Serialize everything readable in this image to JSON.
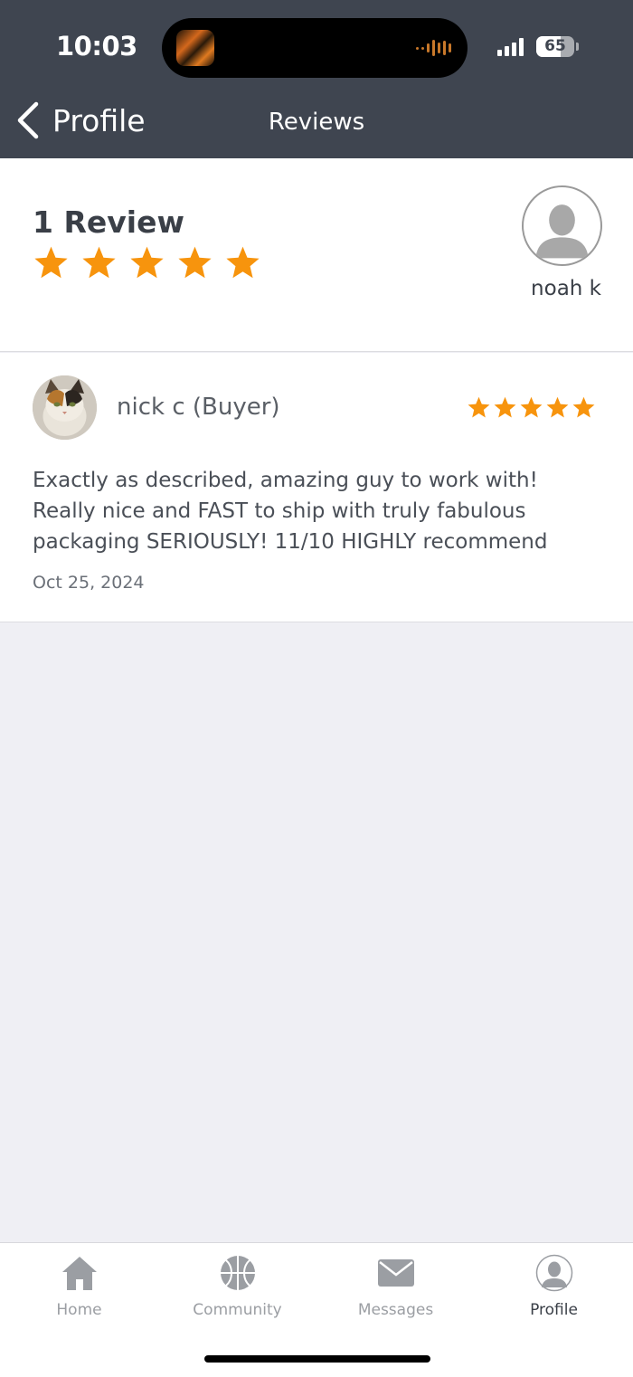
{
  "status_bar": {
    "time": "10:03",
    "battery": "65",
    "battery_level": 0.65
  },
  "nav": {
    "back_label": "Profile",
    "title": "Reviews"
  },
  "summary": {
    "review_count": "1 Review",
    "rating": 5,
    "seller_name": "noah k"
  },
  "reviews": [
    {
      "reviewer": "nick c (Buyer)",
      "rating": 5,
      "text": "Exactly as described, amazing guy to work with! Really nice and FAST to ship with truly fabulous packaging SERIOUSLY! 11/10 HIGHLY recommend",
      "date": "Oct 25, 2024"
    }
  ],
  "tabbar": {
    "tabs": [
      {
        "label": "Home",
        "icon": "home-icon",
        "active": false
      },
      {
        "label": "Community",
        "icon": "basketball-icon",
        "active": false
      },
      {
        "label": "Messages",
        "icon": "mail-icon",
        "active": false
      },
      {
        "label": "Profile",
        "icon": "profile-icon",
        "active": true
      }
    ]
  },
  "colors": {
    "header_bg": "#3f4550",
    "star": "#f7940d",
    "background": "#efeff4"
  }
}
